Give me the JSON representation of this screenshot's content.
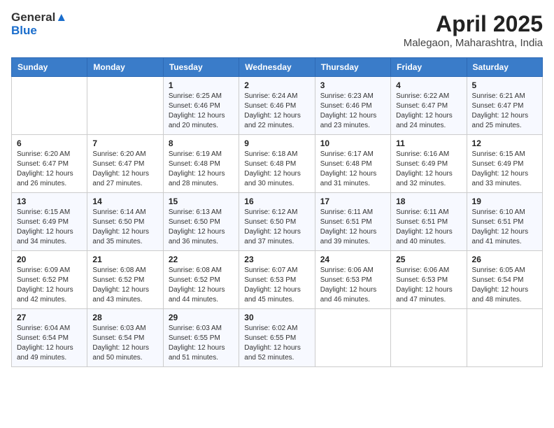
{
  "logo": {
    "general": "General",
    "blue": "Blue"
  },
  "title": "April 2025",
  "location": "Malegaon, Maharashtra, India",
  "days_header": [
    "Sunday",
    "Monday",
    "Tuesday",
    "Wednesday",
    "Thursday",
    "Friday",
    "Saturday"
  ],
  "weeks": [
    [
      {
        "day": "",
        "info": ""
      },
      {
        "day": "",
        "info": ""
      },
      {
        "day": "1",
        "sunrise": "6:25 AM",
        "sunset": "6:46 PM",
        "daylight": "12 hours and 20 minutes."
      },
      {
        "day": "2",
        "sunrise": "6:24 AM",
        "sunset": "6:46 PM",
        "daylight": "12 hours and 22 minutes."
      },
      {
        "day": "3",
        "sunrise": "6:23 AM",
        "sunset": "6:46 PM",
        "daylight": "12 hours and 23 minutes."
      },
      {
        "day": "4",
        "sunrise": "6:22 AM",
        "sunset": "6:47 PM",
        "daylight": "12 hours and 24 minutes."
      },
      {
        "day": "5",
        "sunrise": "6:21 AM",
        "sunset": "6:47 PM",
        "daylight": "12 hours and 25 minutes."
      }
    ],
    [
      {
        "day": "6",
        "sunrise": "6:20 AM",
        "sunset": "6:47 PM",
        "daylight": "12 hours and 26 minutes."
      },
      {
        "day": "7",
        "sunrise": "6:20 AM",
        "sunset": "6:47 PM",
        "daylight": "12 hours and 27 minutes."
      },
      {
        "day": "8",
        "sunrise": "6:19 AM",
        "sunset": "6:48 PM",
        "daylight": "12 hours and 28 minutes."
      },
      {
        "day": "9",
        "sunrise": "6:18 AM",
        "sunset": "6:48 PM",
        "daylight": "12 hours and 30 minutes."
      },
      {
        "day": "10",
        "sunrise": "6:17 AM",
        "sunset": "6:48 PM",
        "daylight": "12 hours and 31 minutes."
      },
      {
        "day": "11",
        "sunrise": "6:16 AM",
        "sunset": "6:49 PM",
        "daylight": "12 hours and 32 minutes."
      },
      {
        "day": "12",
        "sunrise": "6:15 AM",
        "sunset": "6:49 PM",
        "daylight": "12 hours and 33 minutes."
      }
    ],
    [
      {
        "day": "13",
        "sunrise": "6:15 AM",
        "sunset": "6:49 PM",
        "daylight": "12 hours and 34 minutes."
      },
      {
        "day": "14",
        "sunrise": "6:14 AM",
        "sunset": "6:50 PM",
        "daylight": "12 hours and 35 minutes."
      },
      {
        "day": "15",
        "sunrise": "6:13 AM",
        "sunset": "6:50 PM",
        "daylight": "12 hours and 36 minutes."
      },
      {
        "day": "16",
        "sunrise": "6:12 AM",
        "sunset": "6:50 PM",
        "daylight": "12 hours and 37 minutes."
      },
      {
        "day": "17",
        "sunrise": "6:11 AM",
        "sunset": "6:51 PM",
        "daylight": "12 hours and 39 minutes."
      },
      {
        "day": "18",
        "sunrise": "6:11 AM",
        "sunset": "6:51 PM",
        "daylight": "12 hours and 40 minutes."
      },
      {
        "day": "19",
        "sunrise": "6:10 AM",
        "sunset": "6:51 PM",
        "daylight": "12 hours and 41 minutes."
      }
    ],
    [
      {
        "day": "20",
        "sunrise": "6:09 AM",
        "sunset": "6:52 PM",
        "daylight": "12 hours and 42 minutes."
      },
      {
        "day": "21",
        "sunrise": "6:08 AM",
        "sunset": "6:52 PM",
        "daylight": "12 hours and 43 minutes."
      },
      {
        "day": "22",
        "sunrise": "6:08 AM",
        "sunset": "6:52 PM",
        "daylight": "12 hours and 44 minutes."
      },
      {
        "day": "23",
        "sunrise": "6:07 AM",
        "sunset": "6:53 PM",
        "daylight": "12 hours and 45 minutes."
      },
      {
        "day": "24",
        "sunrise": "6:06 AM",
        "sunset": "6:53 PM",
        "daylight": "12 hours and 46 minutes."
      },
      {
        "day": "25",
        "sunrise": "6:06 AM",
        "sunset": "6:53 PM",
        "daylight": "12 hours and 47 minutes."
      },
      {
        "day": "26",
        "sunrise": "6:05 AM",
        "sunset": "6:54 PM",
        "daylight": "12 hours and 48 minutes."
      }
    ],
    [
      {
        "day": "27",
        "sunrise": "6:04 AM",
        "sunset": "6:54 PM",
        "daylight": "12 hours and 49 minutes."
      },
      {
        "day": "28",
        "sunrise": "6:03 AM",
        "sunset": "6:54 PM",
        "daylight": "12 hours and 50 minutes."
      },
      {
        "day": "29",
        "sunrise": "6:03 AM",
        "sunset": "6:55 PM",
        "daylight": "12 hours and 51 minutes."
      },
      {
        "day": "30",
        "sunrise": "6:02 AM",
        "sunset": "6:55 PM",
        "daylight": "12 hours and 52 minutes."
      },
      {
        "day": "",
        "info": ""
      },
      {
        "day": "",
        "info": ""
      },
      {
        "day": "",
        "info": ""
      }
    ]
  ],
  "labels": {
    "sunrise": "Sunrise:",
    "sunset": "Sunset:",
    "daylight": "Daylight:"
  }
}
